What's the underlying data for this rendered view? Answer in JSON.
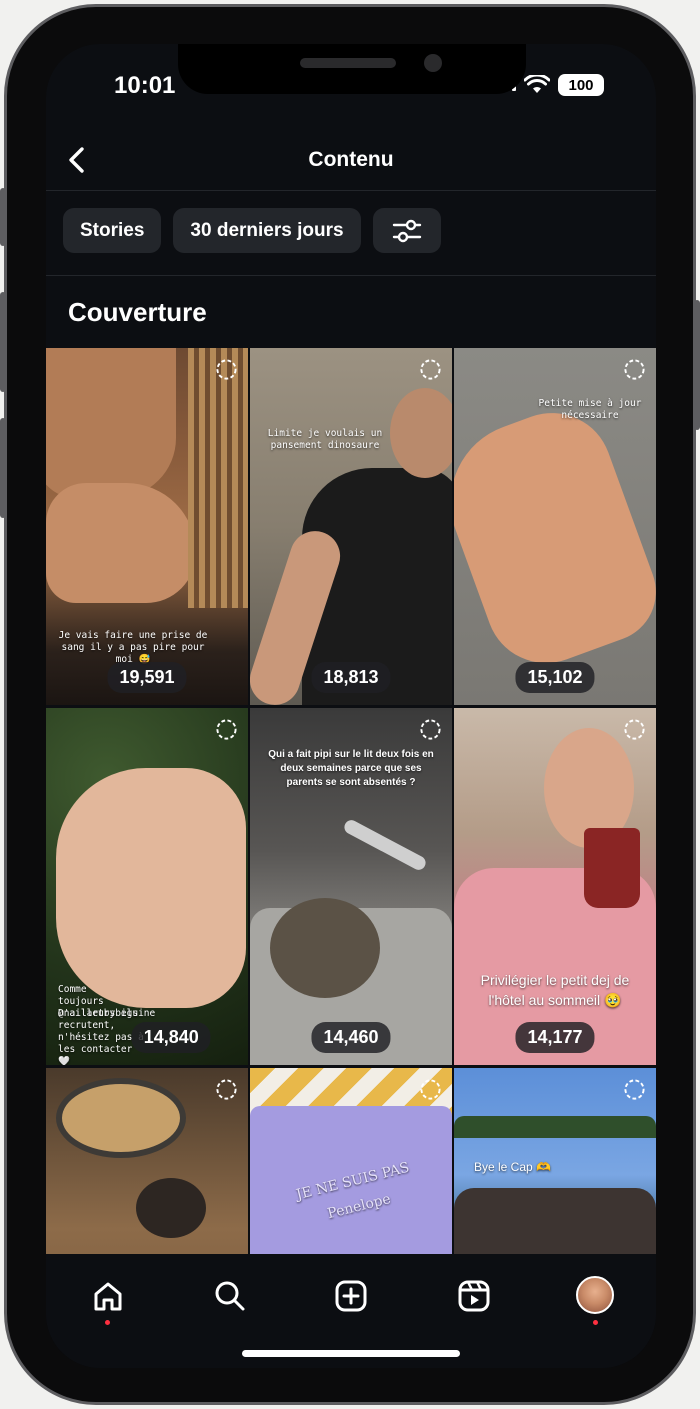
{
  "status_bar": {
    "time": "10:01",
    "battery": "100"
  },
  "header": {
    "title": "Contenu"
  },
  "filters": {
    "type_label": "Stories",
    "period_label": "30 derniers jours"
  },
  "section": {
    "title": "Couverture"
  },
  "tiles": [
    {
      "count": "19,591",
      "caption": "Je vais faire une prise de sang il y a pas pire pour moi 😅"
    },
    {
      "count": "18,813",
      "caption": "Limite je voulais un pansement dinosaure"
    },
    {
      "count": "15,102",
      "caption": "Petite mise à jour nécessaire"
    },
    {
      "count": "14,840",
      "caption_top": "Comme toujours @nailartbybeguine",
      "caption_bottom": "D'ailleurs ils recrutent, n'hésitez pas à les contacter 🤍"
    },
    {
      "count": "14,460",
      "caption": "Qui a fait pipi sur le lit deux fois en deux semaines parce que ses parents se sont absentés ?"
    },
    {
      "count": "14,177",
      "caption": "Privilégier le petit dej de l'hôtel au sommeil 🥹"
    },
    {
      "count": ""
    },
    {
      "count": "",
      "caption": "JE NE SUIS PAS Penelope"
    },
    {
      "count": "",
      "caption": "Bye le Cap 🫶"
    }
  ],
  "nav": {
    "items": [
      "home-icon",
      "search-icon",
      "create-icon",
      "reels-icon",
      "profile-avatar"
    ]
  },
  "colors": {
    "background": "#0c0e12",
    "chip": "#23262b",
    "notification_dot": "#ff3040"
  }
}
